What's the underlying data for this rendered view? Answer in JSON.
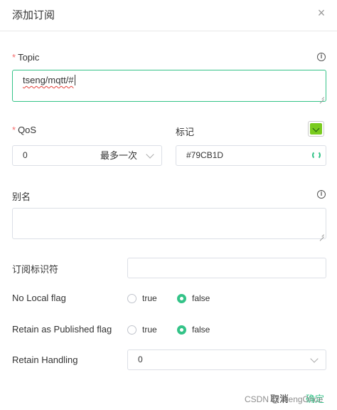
{
  "dialog": {
    "title": "添加订阅",
    "close_icon": "close-icon"
  },
  "topic": {
    "required_mark": "*",
    "label": "Topic",
    "value": "tseng/mqtt/#",
    "info_icon": "info-icon"
  },
  "qos": {
    "required_mark": "*",
    "label": "QoS",
    "value": "0",
    "selected_text": "最多一次"
  },
  "mark": {
    "label": "标记",
    "value": "#79CB1D",
    "color": "#79CB1D"
  },
  "alias": {
    "label": "别名",
    "value": ""
  },
  "subscription_id": {
    "label": "订阅标识符",
    "value": ""
  },
  "no_local": {
    "label": "No Local flag",
    "options": [
      "true",
      "false"
    ],
    "selected": "false"
  },
  "retain_as_published": {
    "label": "Retain as Published flag",
    "options": [
      "true",
      "false"
    ],
    "selected": "false"
  },
  "retain_handling": {
    "label": "Retain Handling",
    "value": "0"
  },
  "footer": {
    "cancel_label": "取消",
    "confirm_label": "确定"
  },
  "watermark": "CSDN @TsengOnce",
  "colors": {
    "accent": "#34c388",
    "required": "#f56c6c",
    "tag": "#79CB1D"
  }
}
